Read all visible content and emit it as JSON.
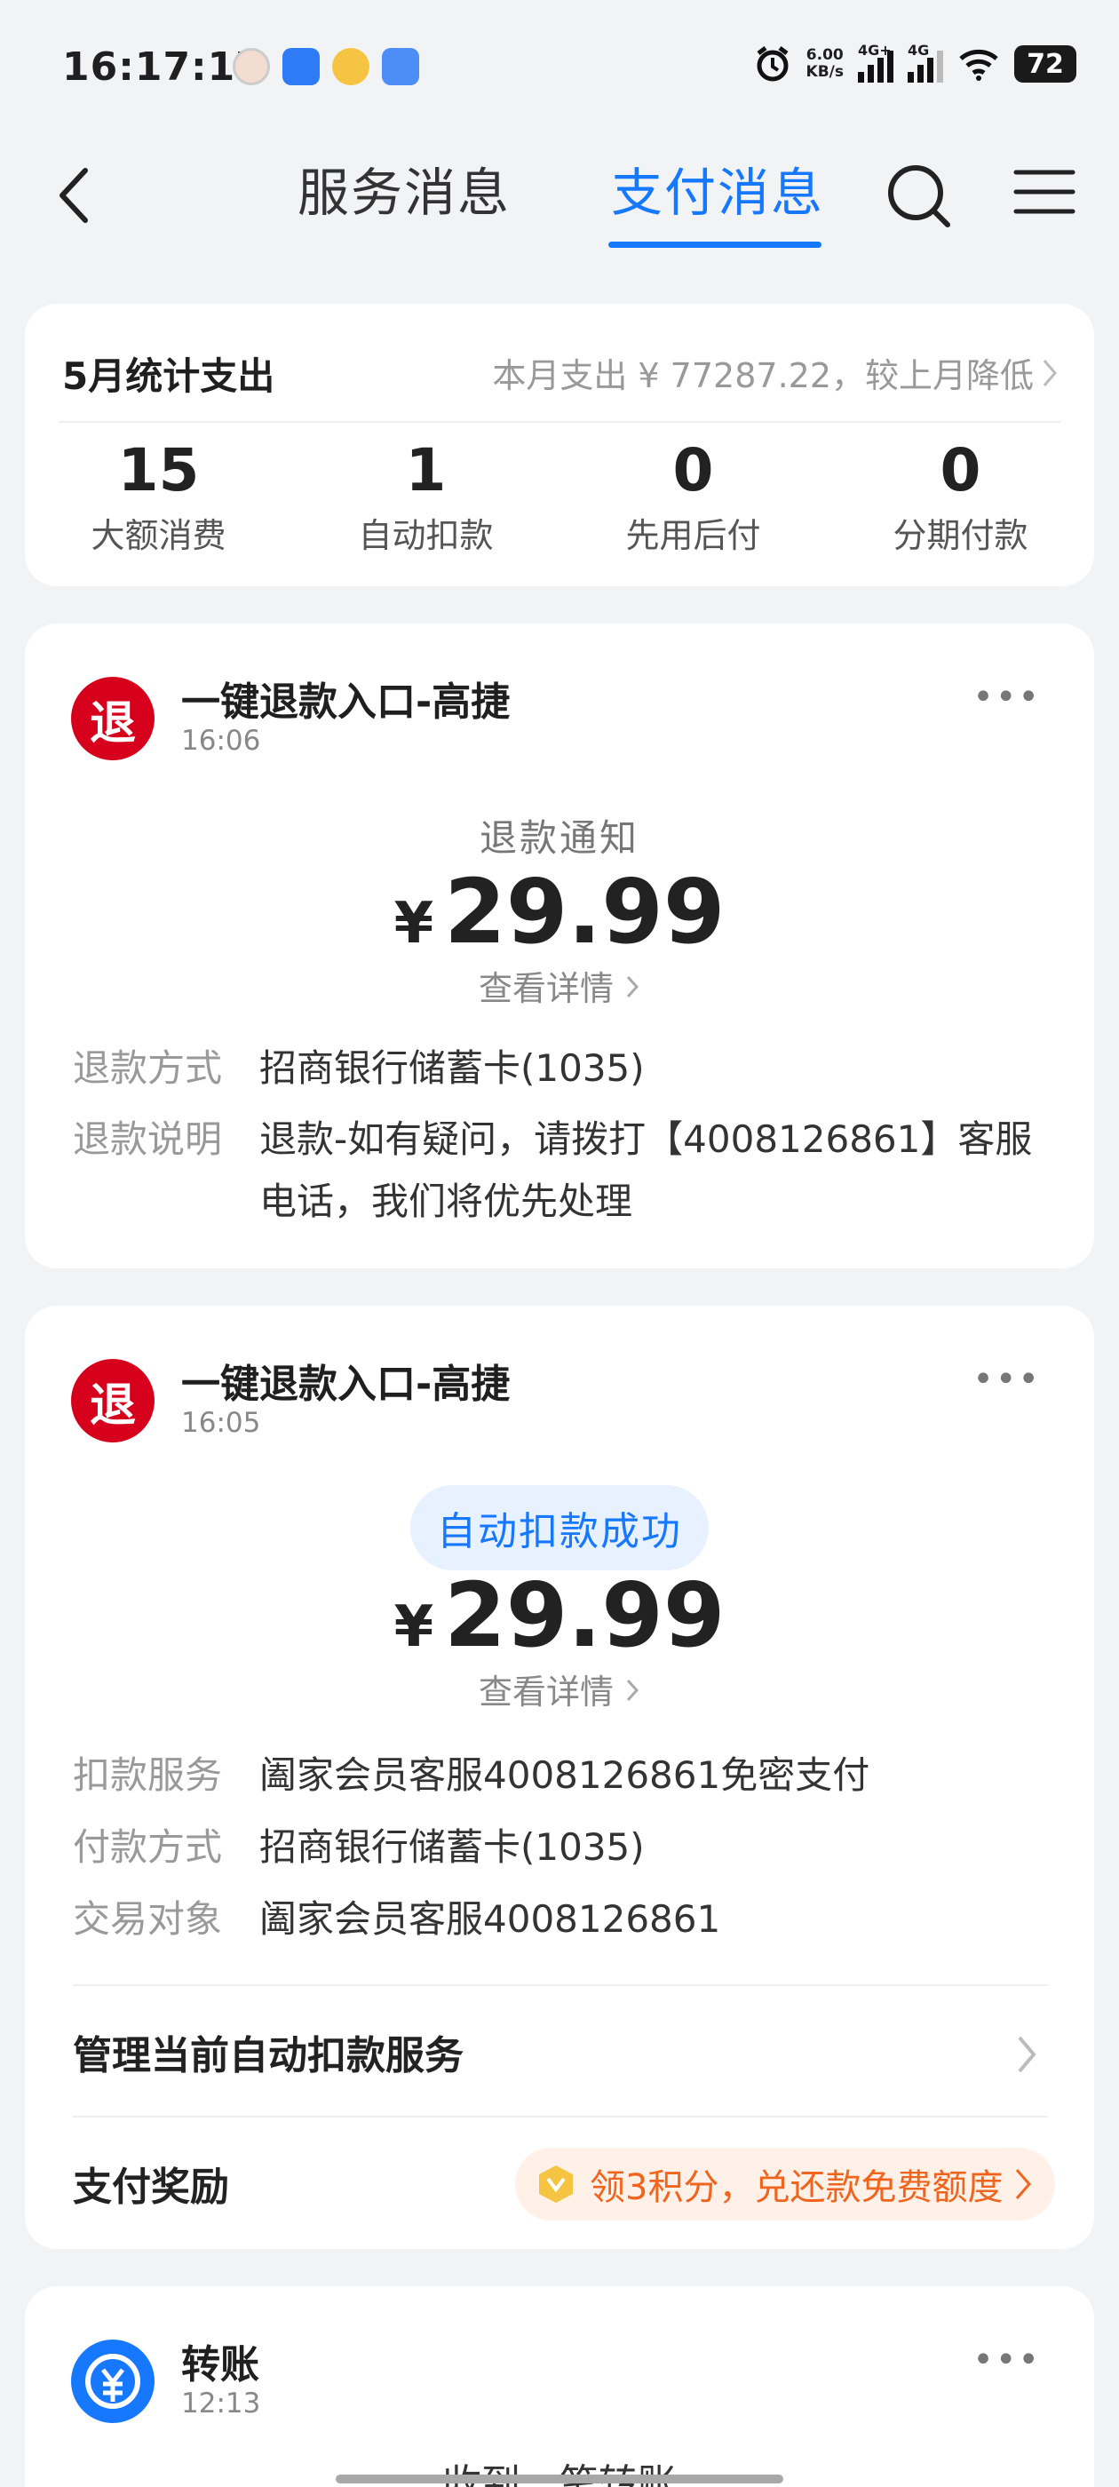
{
  "status_bar": {
    "time": "16:17:17",
    "net_speed_value": "6.00",
    "net_speed_unit": "KB/s",
    "signal_1": "4G+",
    "signal_2": "4G",
    "battery": "72"
  },
  "header": {
    "tab_service": "服务消息",
    "tab_pay": "支付消息"
  },
  "summary": {
    "title": "5月统计支出",
    "right_text": "本月支出 ¥ 77287.22，较上月降低",
    "stats": [
      {
        "num": "15",
        "label": "大额消费"
      },
      {
        "num": "1",
        "label": "自动扣款"
      },
      {
        "num": "0",
        "label": "先用后付"
      },
      {
        "num": "0",
        "label": "分期付款"
      }
    ]
  },
  "refund_card": {
    "avatar_char": "退",
    "title": "一键退款入口-高捷",
    "time": "16:06",
    "kind": "退款通知",
    "currency": "¥",
    "amount": "29.99",
    "detail_link": "查看详情",
    "rows": [
      {
        "label": "退款方式",
        "value": "招商银行储蓄卡(1035)"
      },
      {
        "label": "退款说明",
        "value": "退款-如有疑问，请拨打【4008126861】客服",
        "value2": "电话，我们将优先处理"
      }
    ]
  },
  "debit_card": {
    "avatar_char": "退",
    "title": "一键退款入口-高捷",
    "time": "16:05",
    "badge": "自动扣款成功",
    "currency": "¥",
    "amount": "29.99",
    "detail_link": "查看详情",
    "rows": [
      {
        "label": "扣款服务",
        "value": "阖家会员客服4008126861免密支付"
      },
      {
        "label": "付款方式",
        "value": "招商银行储蓄卡(1035)"
      },
      {
        "label": "交易对象",
        "value": "阖家会员客服4008126861"
      }
    ],
    "manage_label": "管理当前自动扣款服务",
    "reward_label": "支付奖励",
    "reward_pill": "领3积分，兑还款免费额度"
  },
  "transfer_card": {
    "title": "转账",
    "time": "12:13",
    "peek": "收到一笔转账"
  },
  "colors": {
    "accent": "#1677ff",
    "refund_red": "#d6001c",
    "reward_orange": "#f0651d"
  }
}
